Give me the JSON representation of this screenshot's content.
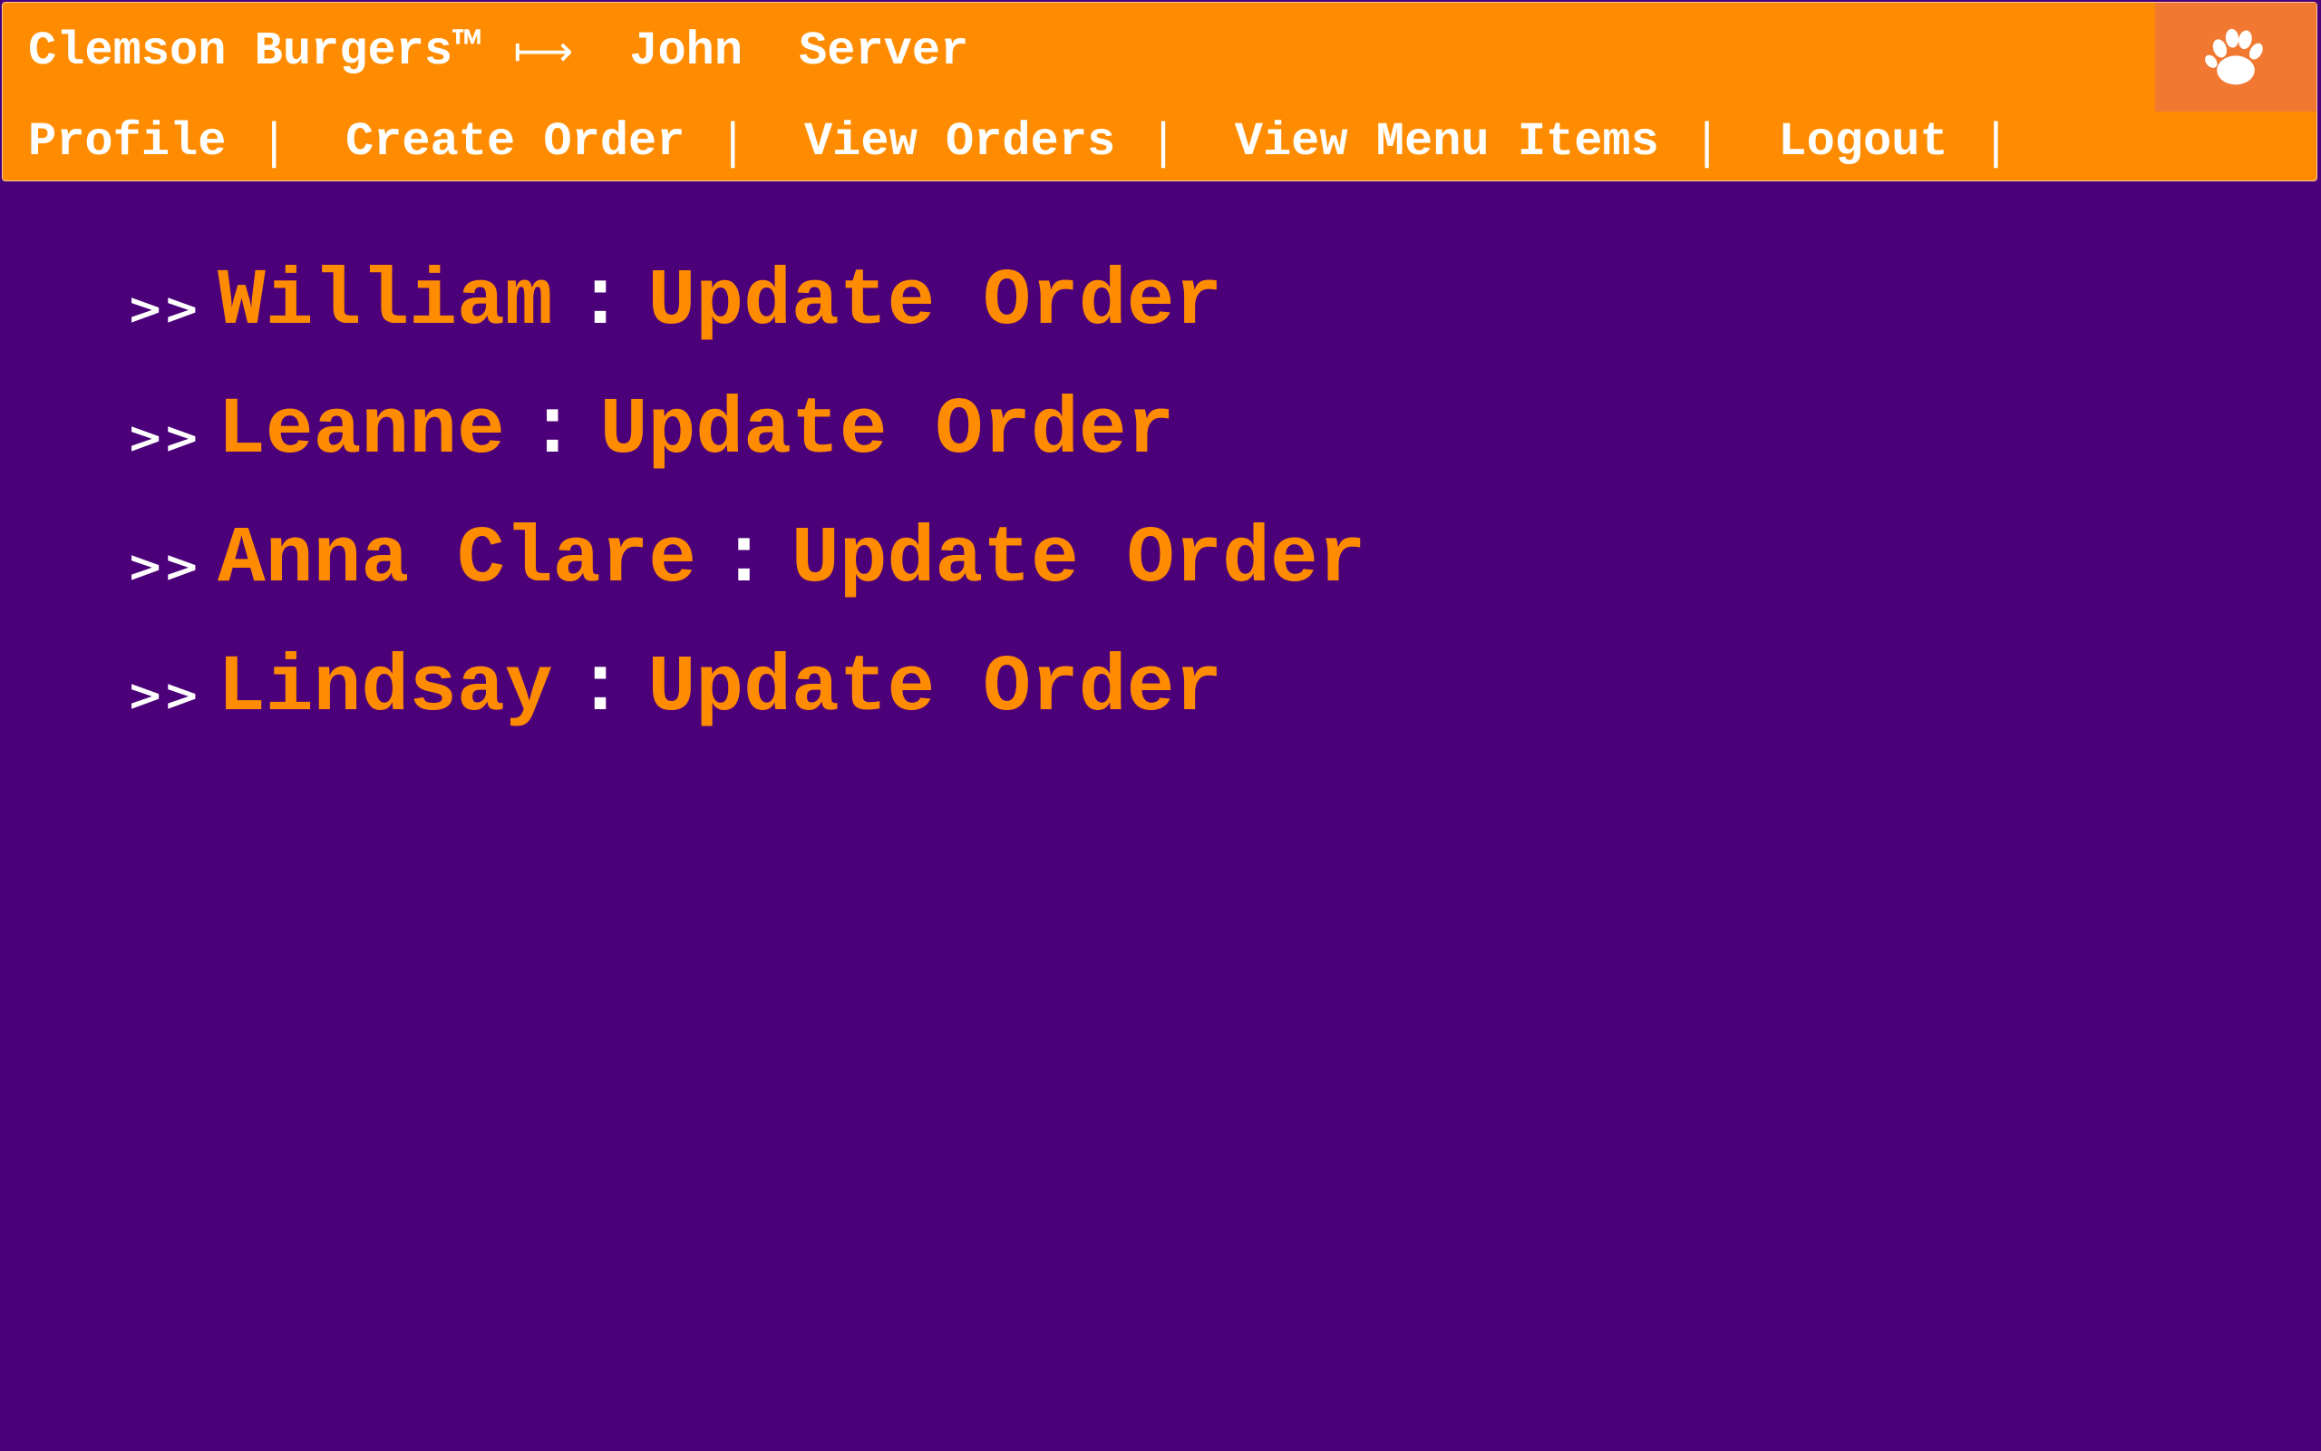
{
  "header": {
    "brand": "Clemson Burgers™",
    "arrow": "⟼",
    "user_name": "John",
    "role": "Server",
    "logo_icon": "tiger-paw-icon",
    "colors": {
      "header_bg": "#ff8c00",
      "logo_bg": "#f07830",
      "page_bg": "#4b0079",
      "accent": "#ff8c00",
      "text": "#ffffff"
    }
  },
  "nav": {
    "items": [
      {
        "label": "Profile",
        "separator": "|"
      },
      {
        "label": "Create Order",
        "separator": "|"
      },
      {
        "label": "View Orders",
        "separator": "|"
      },
      {
        "label": "View Menu Items",
        "separator": "|"
      },
      {
        "label": "Logout",
        "separator": "|"
      }
    ]
  },
  "orders": {
    "items": [
      {
        "prefix": ">>",
        "customer": "William",
        "colon": ":",
        "action": "Update Order"
      },
      {
        "prefix": ">>",
        "customer": "Leanne",
        "colon": ":",
        "action": "Update Order"
      },
      {
        "prefix": ">>",
        "customer": "Anna Clare",
        "colon": ":",
        "action": "Update Order"
      },
      {
        "prefix": ">>",
        "customer": "Lindsay",
        "colon": ":",
        "action": "Update Order"
      }
    ]
  }
}
